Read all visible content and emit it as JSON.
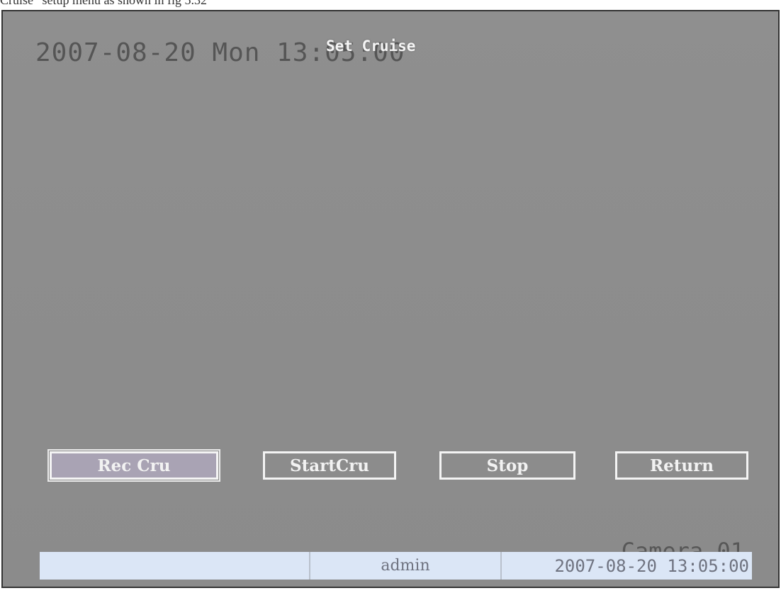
{
  "caption": "Cruise” setup menu as shown in fig 5.32",
  "osd": {
    "datetime": "2007-08-20 Mon 13:05:00",
    "menu_title": "Set Cruise",
    "camera_label": "Camera 01"
  },
  "buttons": {
    "rec_cru": "Rec Cru",
    "start_cru": "StartCru",
    "stop": "Stop",
    "return": "Return"
  },
  "status_bar": {
    "cell_1": "",
    "user": "admin",
    "datetime": "2007-08-20 13:05:00"
  },
  "colors": {
    "screen_bg": "#8d8d8d",
    "button_border": "#f4f4f4",
    "selected_button_bg": "#a9a3b4",
    "status_bar_bg": "#dbe6f6"
  }
}
